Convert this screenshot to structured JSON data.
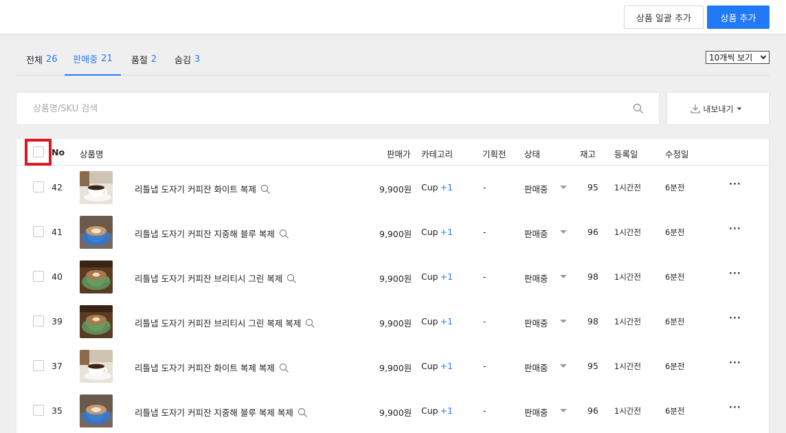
{
  "header": {
    "bulk_add_label": "상품 일괄 추가",
    "add_label": "상품 추가",
    "accent": "#2279f5"
  },
  "tabs": [
    {
      "label": "전체",
      "count": "26"
    },
    {
      "label": "판매중",
      "count": "21"
    },
    {
      "label": "품절",
      "count": "2"
    },
    {
      "label": "숨김",
      "count": "3"
    }
  ],
  "page_size": {
    "value": "10개씩 보기"
  },
  "search": {
    "placeholder": "상품명/SKU 검색"
  },
  "export": {
    "label": "내보내기"
  },
  "columns": {
    "no": "No",
    "name": "상품명",
    "price": "판매가",
    "category": "카테고리",
    "promo": "기획전",
    "status": "상태",
    "stock": "재고",
    "created": "등록일",
    "updated": "수정일"
  },
  "rows": [
    {
      "no": "42",
      "name": "리틀냅 도자기 커피잔 화이트 복제",
      "price": "9,900원",
      "category": "Cup",
      "extra": "+1",
      "promo": "-",
      "status": "판매중",
      "stock": "95",
      "created": "1시간전",
      "updated": "6분전",
      "image": "white-cup"
    },
    {
      "no": "41",
      "name": "리틀냅 도자기 커피잔 지중해 블루 복제",
      "price": "9,900원",
      "category": "Cup",
      "extra": "+1",
      "promo": "-",
      "status": "판매중",
      "stock": "96",
      "created": "1시간전",
      "updated": "6분전",
      "image": "blue-cup"
    },
    {
      "no": "40",
      "name": "리틀냅 도자기 커피잔 브리티시 그린 복제",
      "price": "9,900원",
      "category": "Cup",
      "extra": "+1",
      "promo": "-",
      "status": "판매중",
      "stock": "98",
      "created": "1시간전",
      "updated": "6분전",
      "image": "green-cup"
    },
    {
      "no": "39",
      "name": "리틀냅 도자기 커피잔 브리티시 그린 복제 복제",
      "price": "9,900원",
      "category": "Cup",
      "extra": "+1",
      "promo": "-",
      "status": "판매중",
      "stock": "98",
      "created": "1시간전",
      "updated": "6분전",
      "image": "green-cup"
    },
    {
      "no": "37",
      "name": "리틀냅 도자기 커피잔 화이트 복제 복제",
      "price": "9,900원",
      "category": "Cup",
      "extra": "+1",
      "promo": "-",
      "status": "판매중",
      "stock": "95",
      "created": "1시간전",
      "updated": "6분전",
      "image": "white-cup"
    },
    {
      "no": "35",
      "name": "리틀냅 도자기 커피잔 지중해 블루 복제 복제",
      "price": "9,900원",
      "category": "Cup",
      "extra": "+1",
      "promo": "-",
      "status": "판매중",
      "stock": "96",
      "created": "1시간전",
      "updated": "6분전",
      "image": "blue-cup"
    }
  ]
}
